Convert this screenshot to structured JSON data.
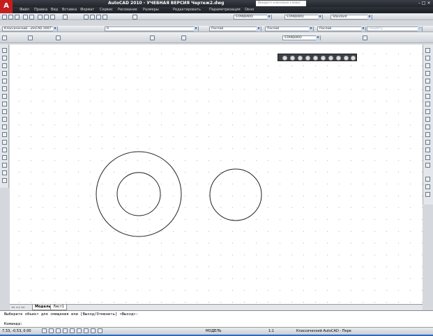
{
  "window": {
    "title": "AutoCAD 2010 - УЧЕБНАЯ ВЕРСИЯ    Чертеж2.dwg",
    "logo": "A",
    "search_placeholder": "Введите ключевое слово/фразу"
  },
  "menu": [
    "Файл",
    "Правка",
    "Вид",
    "Вставка",
    "Формат",
    "Сервис",
    "Рисование",
    "Размеры",
    "Редактировать",
    "Параметризация",
    "Окно"
  ],
  "toolbars": {
    "text_style": "STANDARD",
    "dim_style": "STANDARD",
    "table_style": "Standard",
    "workspace": "Классический...utoCAD 2007",
    "layer": "0",
    "color": "Послой",
    "linetype": "Послой",
    "lineweight": "Послой",
    "plot_style": "Поцвету",
    "mleader_style": "STANDARD"
  },
  "tabs": [
    "Модель",
    "Лист1"
  ],
  "command": {
    "history": "Выберите объект для смещения или [Выход/Отменить] <Выход>:",
    "prompt": "Команда:"
  },
  "status": {
    "coords": "7.33, -0.53, 0.00",
    "model": "МОДЕЛЬ",
    "scale": "1:1",
    "workspace": "Классический AutoCAD - Пере"
  }
}
